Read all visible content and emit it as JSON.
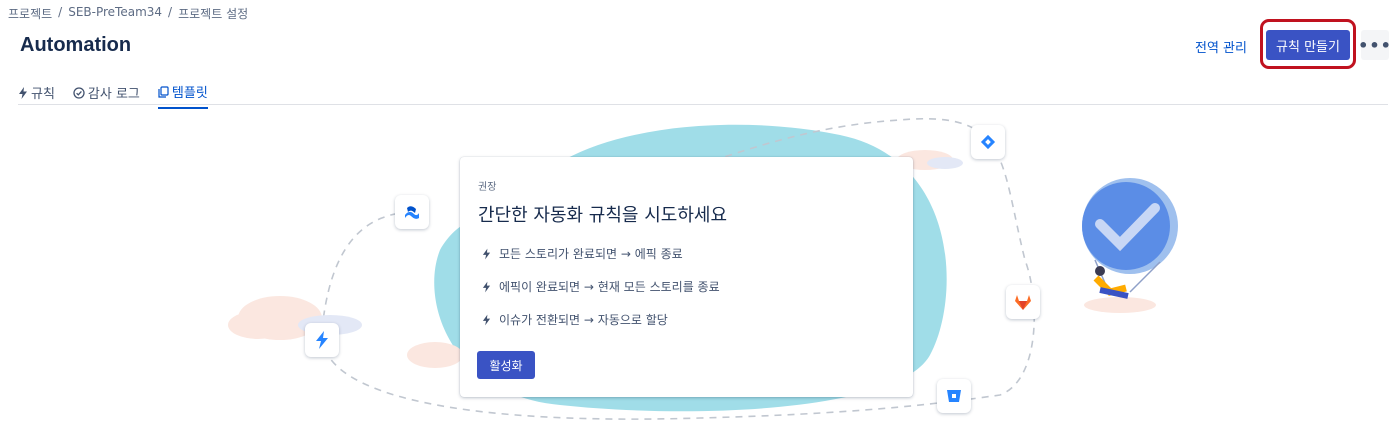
{
  "breadcrumb": {
    "items": [
      "프로젝트",
      "SEB-PreTeam34",
      "프로젝트 설정"
    ],
    "sep": "/"
  },
  "header": {
    "title": "Automation",
    "global_admin": "전역 관리",
    "create_rule": "규칙 만들기",
    "more": "•••"
  },
  "tabs": [
    {
      "label": "규칙",
      "icon": "bolt-icon"
    },
    {
      "label": "감사 로그",
      "icon": "check-circle-icon"
    },
    {
      "label": "템플릿",
      "icon": "copy-icon",
      "active": true
    }
  ],
  "card": {
    "eyebrow": "권장",
    "title": "간단한 자동화 규칙을 시도하세요",
    "items": [
      "모든 스토리가 완료되면 → 에픽 종료",
      "에픽이 완료되면 → 현재 모든 스토리를 종료",
      "이슈가 전환되면 → 자동으로 할당"
    ],
    "activate": "활성화"
  },
  "integrations": [
    "confluence-icon",
    "jira-icon",
    "automation-bolt-icon",
    "gitlab-icon",
    "bitbucket-icon"
  ],
  "colors": {
    "primary": "#3a53c4",
    "link": "#0052cc",
    "highlight": "#c0121f",
    "blob": "#a0dde8"
  }
}
